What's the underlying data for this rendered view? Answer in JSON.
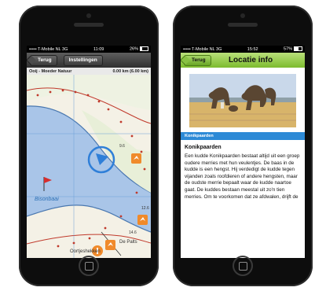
{
  "colors": {
    "accent_green": "#7cbb2e",
    "section_blue": "#2d8ad6",
    "water": "#a9c5e8",
    "marker_orange": "#f08a2b"
  },
  "left_phone": {
    "status": {
      "carrier": "••••• T-Mobile NL",
      "network": "3G",
      "time": "11:09",
      "battery": "26%",
      "battery_level": 0.26
    },
    "nav": {
      "back_label": "Terug",
      "settings_label": "Instellingen"
    },
    "route": {
      "name": "Ooij - Moeder Natuur",
      "distance": "0.00 km (6.00 km)"
    },
    "map": {
      "water_label": "Bisonbaai",
      "town_label": "Oortjeshekken",
      "town_label_2": "De Palts",
      "spot_heights": [
        "9.6",
        "12.6",
        "14.6"
      ],
      "icons": [
        "location-arrow-icon",
        "bird-marker-icon",
        "info-marker-icon",
        "flag-icon"
      ]
    }
  },
  "right_phone": {
    "status": {
      "carrier": "••••• T-Mobile NL",
      "network": "3G",
      "time": "15:52",
      "battery": "57%",
      "battery_level": 0.57
    },
    "nav": {
      "back_label": "Terug",
      "title": "Locatie info"
    },
    "section_label": "Konikpaarden",
    "article": {
      "heading": "Konikpaarden",
      "body": "Een kudde Konikpaarden bestaat altijd uit een groep oudere merries met hun veulentjes. De baas in de kudde is een hengst. Hij verdedigt de kudde tegen vijanden zoals roofdieren of andere hengsten, maar de oudste merrie bepaalt waar de kudde naartoe gaat. De kuddes bestaan meestal uit zo'n tien merries. Om te voorkomen dat ze afdwalen, drijft de"
    }
  }
}
